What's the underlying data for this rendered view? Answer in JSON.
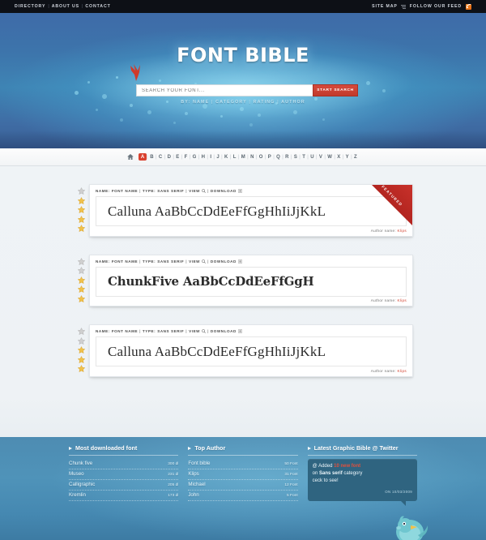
{
  "topbar": {
    "left_links": [
      "DIRECTORY",
      "ABOUT US",
      "CONTACT"
    ],
    "sitemap_label": "SITE MAP",
    "sitemap_icon": "sitemap-icon",
    "feed_label": "FOLLOW OUR FEED",
    "feed_icon": "rss-icon",
    "separator": "|"
  },
  "hero": {
    "logo": "FONT BIBLE",
    "search": {
      "placeholder": "SEARCH YOUR FONT...",
      "value": "",
      "button_label": "START SEARCH"
    },
    "subnav_prefix": "BY:",
    "subnav_items": [
      "NAME",
      "CATEGORY",
      "RATING",
      "AUTHOR"
    ],
    "subnav_separator": "|",
    "bird_icon": "red-bird-icon",
    "accent_red": "#c13a2c",
    "bg_blue": "#3d74ab"
  },
  "alphabet_nav": {
    "home_icon": "home-icon",
    "letters": [
      "A",
      "B",
      "C",
      "D",
      "E",
      "F",
      "G",
      "H",
      "I",
      "J",
      "K",
      "L",
      "M",
      "N",
      "O",
      "P",
      "Q",
      "R",
      "S",
      "T",
      "U",
      "V",
      "W",
      "X",
      "Y",
      "Z"
    ],
    "active_letter": "A",
    "separator": "|",
    "active_color": "#d9412f"
  },
  "font_cards": [
    {
      "meta_name_label": "NAME:",
      "meta_name_value": "FONT NAME",
      "meta_type_label": "TYPE:",
      "meta_type_value": "SANS SERIF",
      "view_label": "VIEW",
      "view_icon": "magnifier-icon",
      "download_label": "DOWNLOAD",
      "download_icon": "download-icon",
      "separator": "|",
      "specimen": "Calluna AaBbCcDdEeFfGgHhIiJjKkL",
      "specimen_style": "serif",
      "author_label": "Author name:",
      "author_name": "Klips",
      "rating": 4,
      "stars_total": 5,
      "stars_filled_from_bottom": true,
      "featured": true,
      "featured_label": "FEATURED"
    },
    {
      "meta_name_label": "NAME:",
      "meta_name_value": "FONT NAME",
      "meta_type_label": "TYPE:",
      "meta_type_value": "SANS SERIF",
      "view_label": "VIEW",
      "view_icon": "magnifier-icon",
      "download_label": "DOWNLOAD",
      "download_icon": "download-icon",
      "separator": "|",
      "specimen": "ChunkFive AaBbCcDdEeFfGgH",
      "specimen_style": "slab",
      "author_label": "Author name:",
      "author_name": "Klips",
      "rating": 3,
      "stars_total": 5,
      "stars_filled_from_bottom": true,
      "featured": false,
      "featured_label": "FEATURED"
    },
    {
      "meta_name_label": "NAME:",
      "meta_name_value": "FONT NAME",
      "meta_type_label": "TYPE:",
      "meta_type_value": "SANS SERIF",
      "view_label": "VIEW",
      "view_icon": "magnifier-icon",
      "download_label": "DOWNLOAD",
      "download_icon": "download-icon",
      "separator": "|",
      "specimen": "Calluna AaBbCcDdEeFfGgHhIiJjKkL",
      "specimen_style": "serif",
      "author_label": "Author name:",
      "author_name": "Klips",
      "rating": 3,
      "stars_total": 5,
      "stars_filled_from_bottom": true,
      "featured": false,
      "featured_label": "FEATURED"
    }
  ],
  "footer": {
    "col_downloads": {
      "title": "Most downloaded font",
      "rows": [
        {
          "name": "Chunk five",
          "value": "300 dl"
        },
        {
          "name": "Museo",
          "value": "231 dl"
        },
        {
          "name": "Calligraphic",
          "value": "205 dl"
        },
        {
          "name": "Kremlin",
          "value": "173 dl"
        }
      ]
    },
    "col_authors": {
      "title": "Top Author",
      "rows": [
        {
          "name": "Font bible",
          "value": "50 Font"
        },
        {
          "name": "Klips",
          "value": "31 Font"
        },
        {
          "name": "Michael",
          "value": "12 Font"
        },
        {
          "name": "John",
          "value": "5 Font"
        }
      ]
    },
    "col_twitter": {
      "title": "Latest Graphic Bible @ Twitter",
      "tweet_prefix": "@ Added",
      "tweet_highlight": "10 new font",
      "tweet_mid": "on",
      "tweet_bold": "Sans serif",
      "tweet_tail": "category",
      "tweet_line3": "ceck to see!",
      "tweet_date": "ON 10/03/2009",
      "bird_icon": "twitter-bird-icon"
    }
  }
}
